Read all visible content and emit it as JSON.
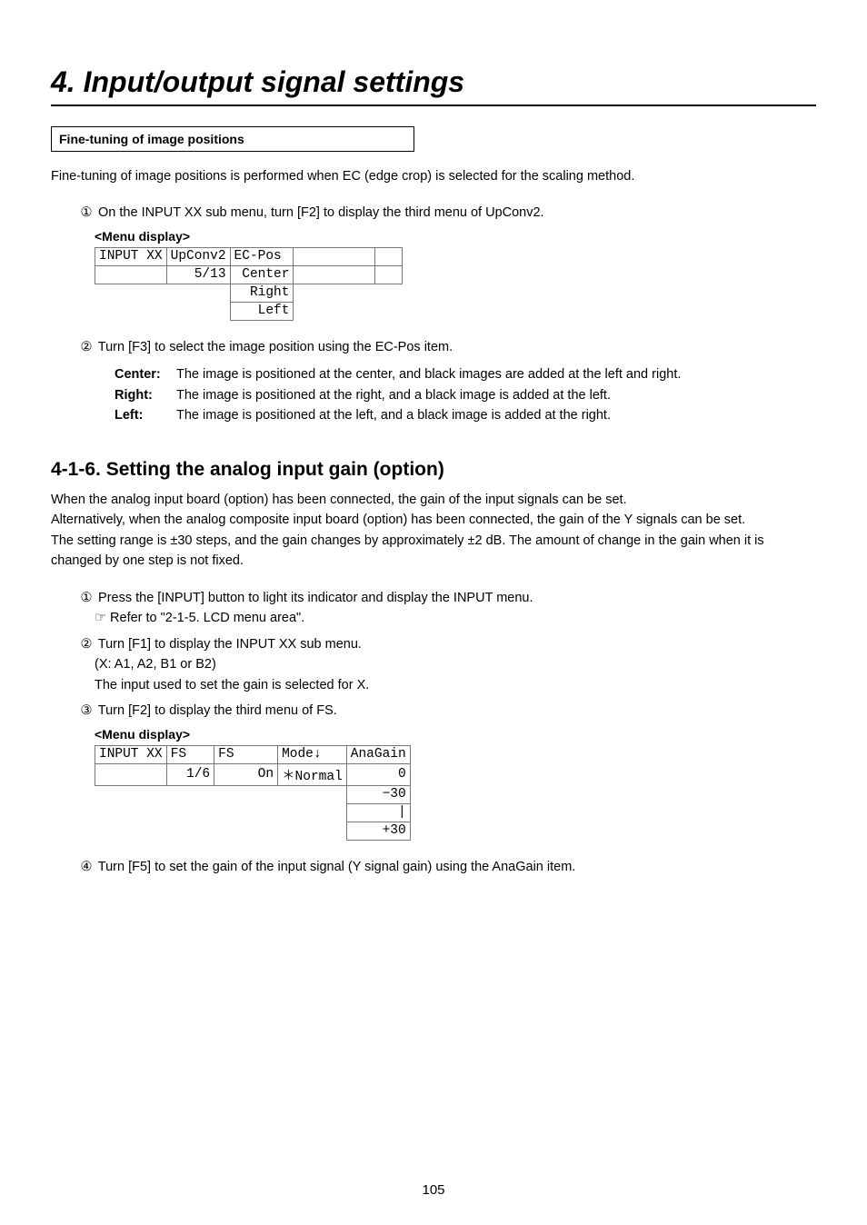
{
  "chapter": {
    "title": "4. Input/output signal settings"
  },
  "boxHeading": "Fine-tuning of image positions",
  "intro1": "Fine-tuning of image positions is performed when EC (edge crop) is selected for the scaling method.",
  "stepA1": {
    "num": "①",
    "text": "On the INPUT XX sub menu, turn [F2] to display the third menu of UpConv2.",
    "menuLabel": "<Menu display>",
    "lcd": {
      "r1c1": "INPUT XX",
      "r1c2": "UpConv2",
      "r1c3": "EC-Pos ",
      "r1c4": "",
      "r1c5": "",
      "r2c1": "",
      "r2c2": "   5/13",
      "r2c3": " Center",
      "r2c4": "",
      "r2c5": "",
      "r3c3": "  Right",
      "r4c3": "   Left"
    }
  },
  "stepA2": {
    "num": "②",
    "text": "Turn [F3] to select the image position using the EC-Pos item.",
    "defs": {
      "center": {
        "term": "Center:",
        "desc": "The image is positioned at the center, and black images are added at the left and right."
      },
      "right": {
        "term": "Right:",
        "desc": "The image is positioned at the right, and a black image is added at the left."
      },
      "left": {
        "term": "Left:",
        "desc": "The image is positioned at the left, and a black image is added at the right."
      }
    }
  },
  "section416": {
    "heading": "4-1-6. Setting the analog input gain (option)",
    "para1": "When the analog input board (option) has been connected, the gain of the input signals can be set.",
    "para2": "Alternatively, when the analog composite input board (option) has been connected, the gain of the Y signals can be set.",
    "para3": "The setting range is ±30 steps, and the gain changes by approximately ±2 dB. The amount of change in the gain when it is changed by one step is not fixed."
  },
  "stepB1": {
    "num": "①",
    "text": "Press the [INPUT] button to light its indicator and display the INPUT menu.",
    "ref": "☞ Refer to \"2-1-5. LCD menu area\"."
  },
  "stepB2": {
    "num": "②",
    "text": "Turn [F1] to display the INPUT XX sub menu.",
    "sub1": "(X: A1, A2, B1 or B2)",
    "sub2": "The input used to set the gain is selected for X."
  },
  "stepB3": {
    "num": "③",
    "text": "Turn [F2] to display the third menu of FS.",
    "menuLabel": "<Menu display>",
    "lcd": {
      "r1c1": "INPUT XX",
      "r1c2": "FS   ",
      "r1c3": "FS     ",
      "r1c4": "Mode↓  ",
      "r1c5": "AnaGain",
      "r2c1": "",
      "r2c2": "  1/6",
      "r2c3": "     On",
      "r2c4": "＊Normal",
      "r2c5": "      0",
      "r3c5": "    −30",
      "r4c5": "      |",
      "r5c5": "    +30"
    }
  },
  "stepB4": {
    "num": "④",
    "text": "Turn [F5] to set the gain of the input signal (Y signal gain) using the AnaGain item."
  },
  "pagenum": "105"
}
